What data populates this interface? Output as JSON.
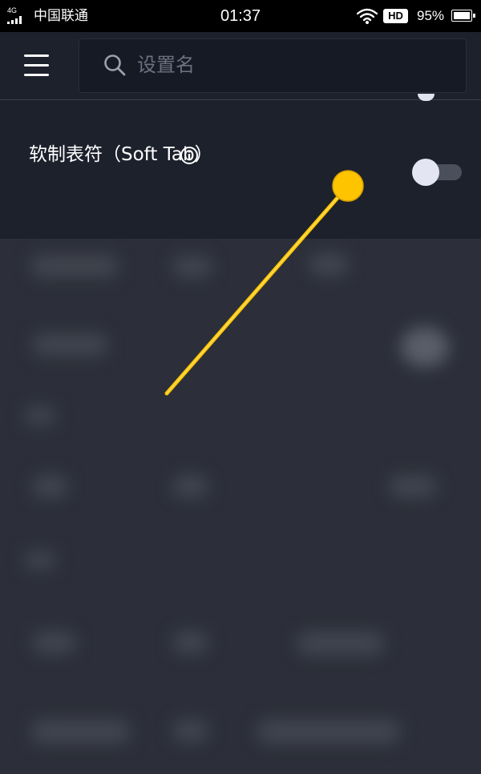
{
  "status_bar": {
    "network": "4G",
    "carrier": "中国联通",
    "time": "01:37",
    "hd_badge": "HD",
    "battery_pct": "95%",
    "battery_level": 0.95
  },
  "header": {
    "menu_icon": "hamburger-menu-icon",
    "search": {
      "placeholder": "设置名",
      "value": "",
      "icon": "search-icon"
    }
  },
  "setting": {
    "label": "软制表符（Soft Tab）",
    "info_icon": "info-icon",
    "toggle_on": false
  },
  "colors": {
    "status_bar_bg": "#000000",
    "header_bg": "#1d212c",
    "overlay_bg": "#2c2f39",
    "annotation": "#ffc400"
  }
}
